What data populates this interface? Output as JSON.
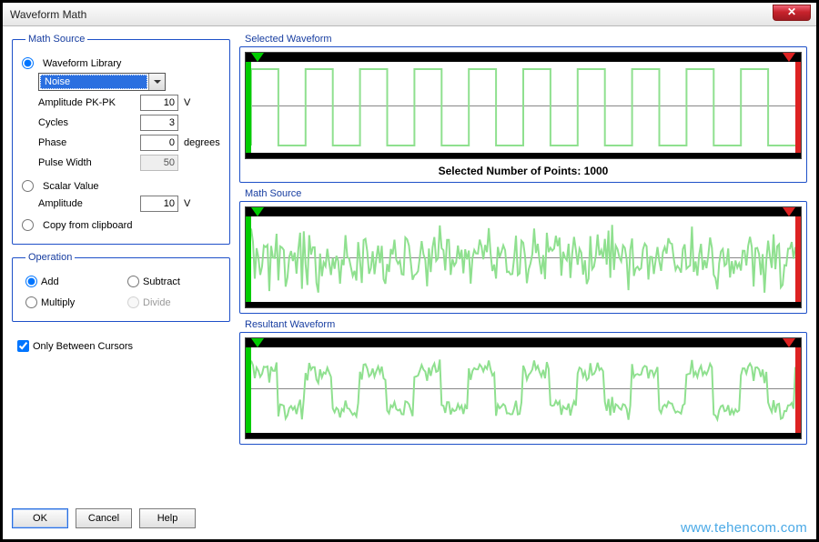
{
  "window": {
    "title": "Waveform Math"
  },
  "math_source": {
    "legend": "Math Source",
    "lib": {
      "radio_label": "Waveform Library",
      "dropdown_value": "Noise",
      "amp_label": "Amplitude PK-PK",
      "amp_value": "10",
      "amp_unit": "V",
      "cycles_label": "Cycles",
      "cycles_value": "3",
      "phase_label": "Phase",
      "phase_value": "0",
      "phase_unit": "degrees",
      "pw_label": "Pulse Width",
      "pw_value": "50"
    },
    "scalar": {
      "radio_label": "Scalar Value",
      "amp_label": "Amplitude",
      "amp_value": "10",
      "amp_unit": "V"
    },
    "clipboard_label": "Copy from clipboard"
  },
  "operation": {
    "legend": "Operation",
    "add": "Add",
    "subtract": "Subtract",
    "multiply": "Multiply",
    "divide": "Divide"
  },
  "only_cursors_label": "Only Between Cursors",
  "buttons": {
    "ok": "OK",
    "cancel": "Cancel",
    "help": "Help"
  },
  "panels": {
    "selected": {
      "legend": "Selected Waveform",
      "points_text": "Selected Number of Points: 1000"
    },
    "source": {
      "legend": "Math Source"
    },
    "result": {
      "legend": "Resultant Waveform"
    }
  },
  "watermark": "www.tehencom.com",
  "chart_data": [
    {
      "name": "selected_waveform",
      "type": "line",
      "waveform": "square",
      "cycles": 10,
      "amplitude": 5,
      "offset": 0,
      "xlim": [
        0,
        1000
      ],
      "ylim": [
        -5,
        5
      ],
      "points": 1000
    },
    {
      "name": "math_source_noise",
      "type": "line",
      "waveform": "noise",
      "amplitude_pk_pk": 10,
      "mean": 0,
      "xlim": [
        0,
        1000
      ],
      "ylim": [
        -5,
        5
      ],
      "points": 1000
    },
    {
      "name": "resultant_waveform",
      "type": "line",
      "waveform": "square_plus_noise",
      "base_cycles": 10,
      "base_amplitude": 5,
      "noise_amplitude_pk_pk": 10,
      "xlim": [
        0,
        1000
      ],
      "ylim": [
        -10,
        10
      ],
      "points": 1000
    }
  ]
}
